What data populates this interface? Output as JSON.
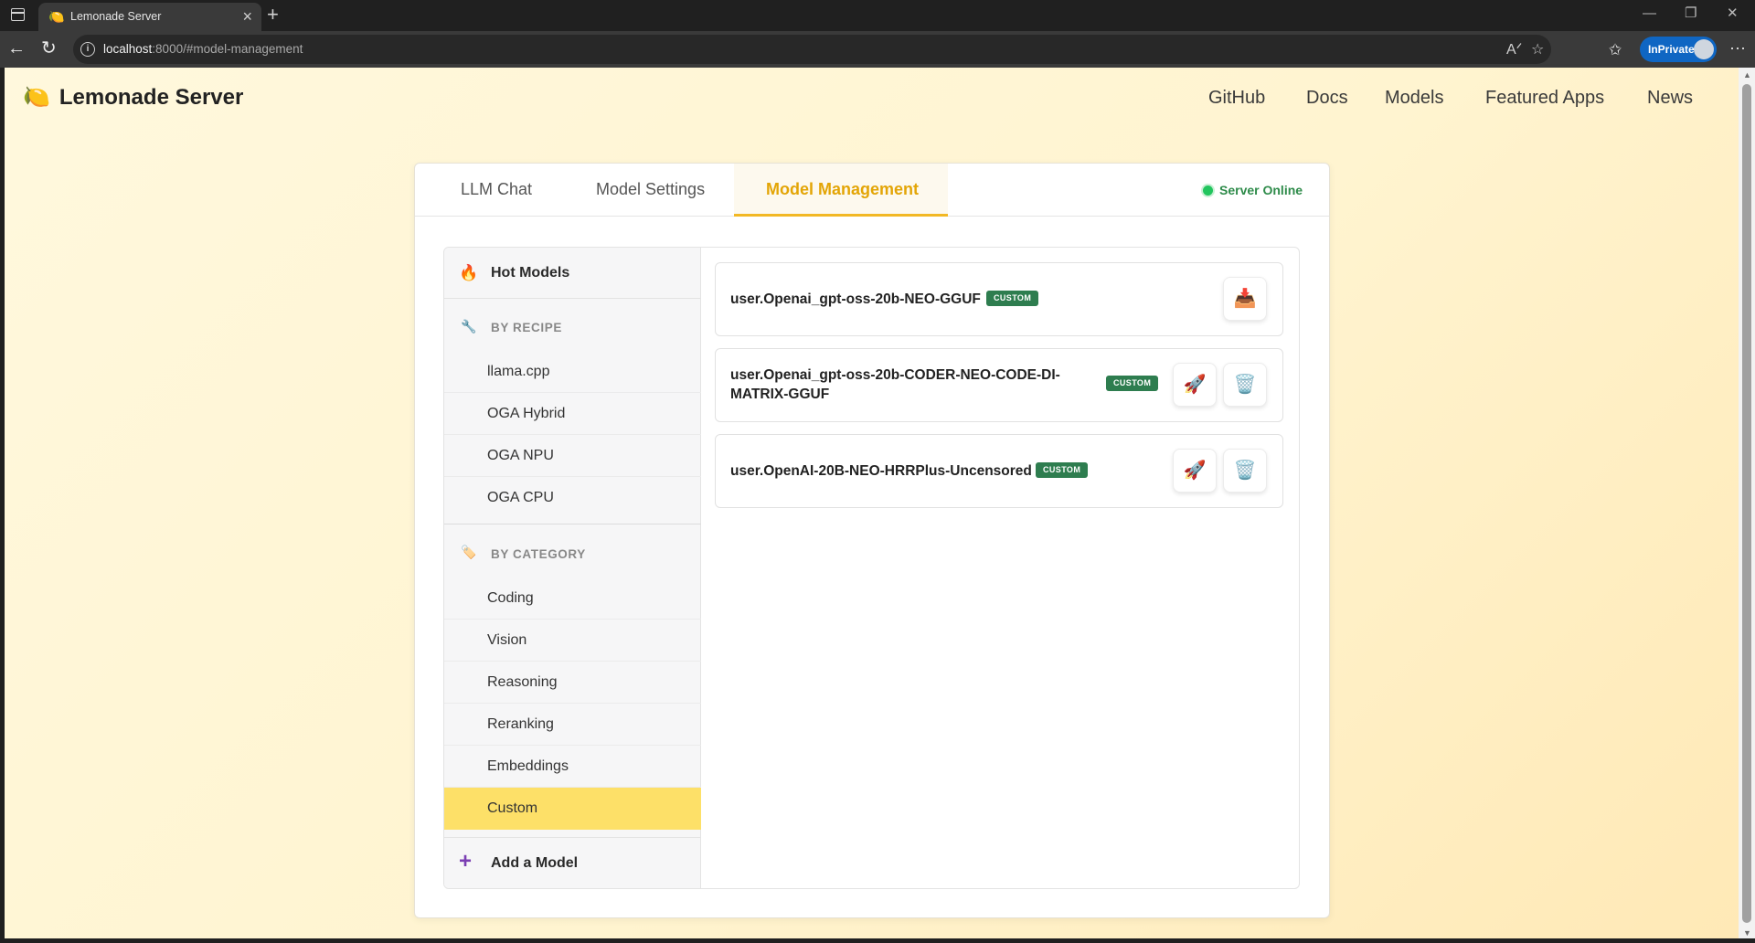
{
  "browser": {
    "tab_title": "Lemonade Server",
    "tab_favicon": "lemon-icon",
    "url_host": "localhost",
    "url_rest": ":8000/#model-management",
    "inprivate_label": "InPrivate"
  },
  "site": {
    "brand": "Lemonade Server",
    "nav": [
      "GitHub",
      "Docs",
      "Models",
      "Featured Apps",
      "News"
    ]
  },
  "tabs": [
    "LLM Chat",
    "Model Settings",
    "Model Management"
  ],
  "active_tab": "Model Management",
  "server_status": "Server Online",
  "status_color": "#22c55e",
  "sidebar": {
    "hot": "Hot Models",
    "recipe_header": "BY RECIPE",
    "recipes": [
      "llama.cpp",
      "OGA Hybrid",
      "OGA NPU",
      "OGA CPU"
    ],
    "category_header": "BY CATEGORY",
    "categories": [
      "Coding",
      "Vision",
      "Reasoning",
      "Reranking",
      "Embeddings",
      "Custom"
    ],
    "active_category": "Custom",
    "add_model": "Add a Model"
  },
  "models": [
    {
      "name": "user.Openai_gpt-oss-20b-NEO-GGUF",
      "badge": "CUSTOM",
      "actions": [
        "download-icon"
      ]
    },
    {
      "name": "user.Openai_gpt-oss-20b-CODER-NEO-CODE-DI-MATRIX-GGUF",
      "name_line1": "user.Openai_gpt-oss-20b-CODER-NEO-CODE-DI-",
      "name_line2": "MATRIX-GGUF",
      "badge": "CUSTOM",
      "actions": [
        "rocket-icon",
        "trash-icon"
      ]
    },
    {
      "name": "user.OpenAI-20B-NEO-HRRPlus-Uncensored",
      "badge": "CUSTOM",
      "actions": [
        "rocket-icon",
        "trash-icon"
      ]
    }
  ],
  "colors": {
    "accent": "#f2b824",
    "active_item": "#fde068",
    "badge": "#2e7d4f"
  }
}
